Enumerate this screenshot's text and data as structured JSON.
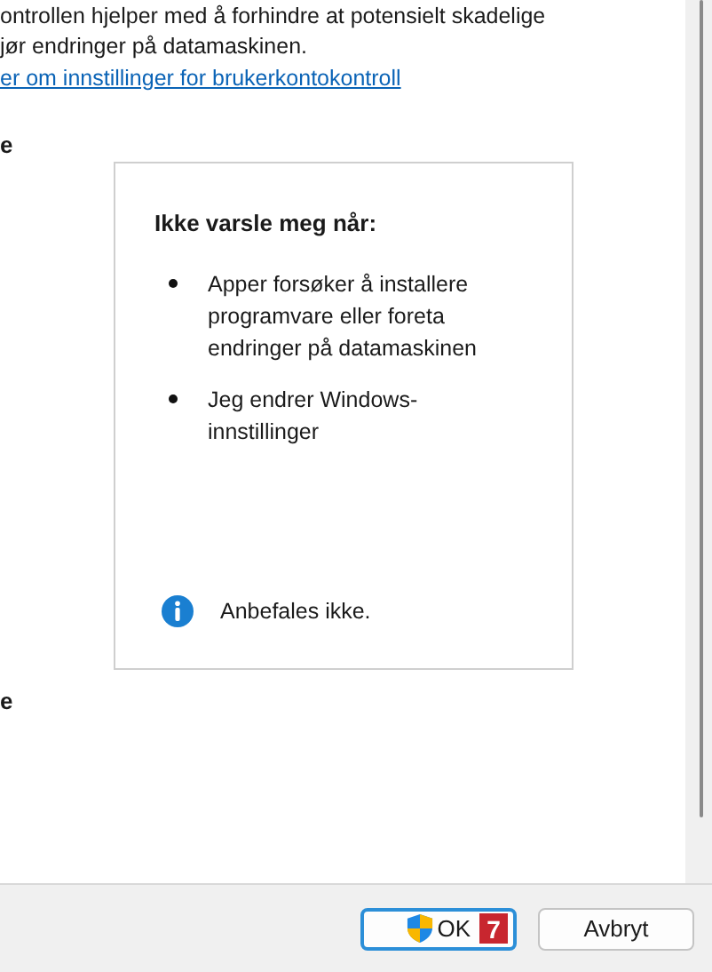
{
  "intro": {
    "lines": [
      "ontrollen hjelper med å forhindre at potensielt skadelige",
      "jør endringer på datamaskinen."
    ],
    "link": "er om innstillinger for brukerkontokontroll"
  },
  "slider_labels": [
    "e",
    "e"
  ],
  "description": {
    "heading": "Ikke varsle meg når:",
    "bullets": [
      "Apper forsøker å installere programvare eller foreta endringer på datamaskinen",
      "Jeg endrer Windows-innstillinger"
    ],
    "note": "Anbefales ikke."
  },
  "buttons": [
    {
      "label": "OK",
      "kind": "shield",
      "badge": "7"
    },
    {
      "label": "Avbryt",
      "kind": "plain"
    }
  ]
}
